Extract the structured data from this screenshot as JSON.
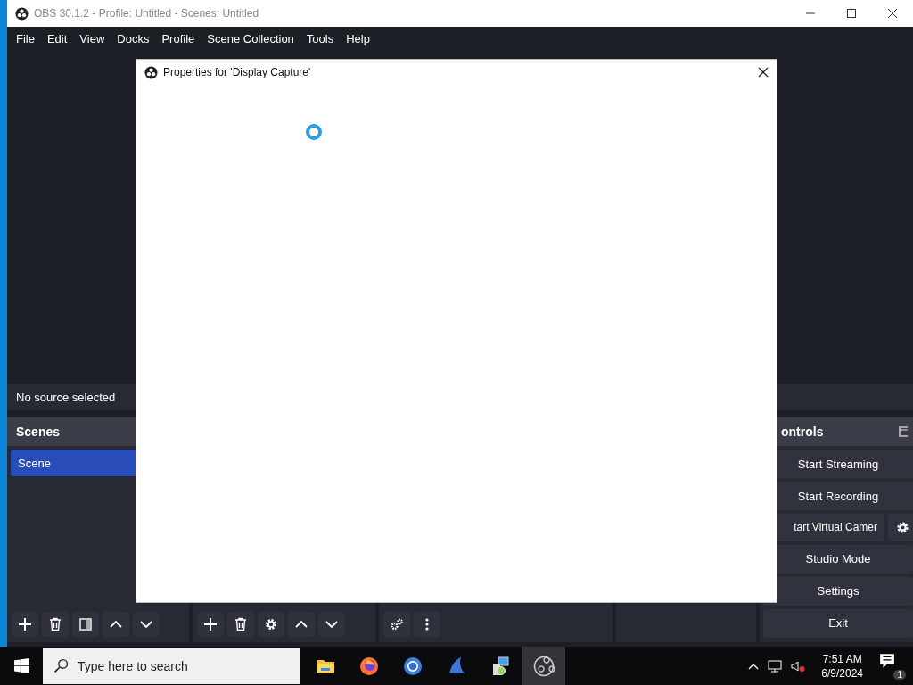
{
  "window": {
    "title": "OBS 30.1.2 - Profile: Untitled - Scenes: Untitled"
  },
  "menu": [
    "File",
    "Edit",
    "View",
    "Docks",
    "Profile",
    "Scene Collection",
    "Tools",
    "Help"
  ],
  "source_bar": {
    "text": "No source selected"
  },
  "scenes": {
    "title": "Scenes",
    "items": [
      {
        "label": "Scene",
        "selected": true
      }
    ]
  },
  "controls": {
    "title": "ontrols",
    "buttons": [
      {
        "label": "Start Streaming",
        "kind": "plain"
      },
      {
        "label": "Start Recording",
        "kind": "plain"
      },
      {
        "label": "tart Virtual Camer",
        "kind": "with_settings"
      },
      {
        "label": "Studio Mode",
        "kind": "plain"
      },
      {
        "label": "Settings",
        "kind": "plain"
      },
      {
        "label": "Exit",
        "kind": "plain"
      }
    ]
  },
  "dialog": {
    "title": "Properties for 'Display Capture'",
    "loading": true
  },
  "taskbar": {
    "search_placeholder": "Type here to search",
    "time": "7:51 AM",
    "date": "6/9/2024",
    "notification_count": "1"
  }
}
